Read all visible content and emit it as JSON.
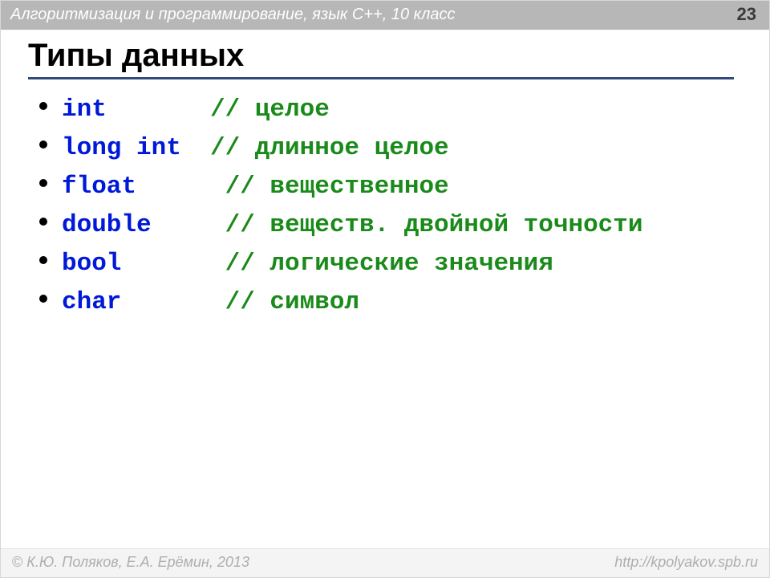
{
  "header": {
    "course": "Алгоритмизация и программирование, язык  C++, 10 класс",
    "page": "23"
  },
  "title": "Типы данных",
  "items": [
    {
      "type": "int",
      "pad": "     ",
      "comment": "// целое"
    },
    {
      "type": "long int",
      "pad": "",
      "comment": "// длинное целое"
    },
    {
      "type": "float",
      "pad": "   ",
      "comment": " // вещественное"
    },
    {
      "type": "double",
      "pad": "  ",
      "comment": " // веществ. двойной точности"
    },
    {
      "type": "bool",
      "pad": "    ",
      "comment": " // логические значения"
    },
    {
      "type": "char",
      "pad": "    ",
      "comment": " // символ"
    }
  ],
  "footer": {
    "copyright": " К.Ю. Поляков, Е.А. Ерёмин, 2013",
    "url": "http://kpolyakov.spb.ru"
  }
}
